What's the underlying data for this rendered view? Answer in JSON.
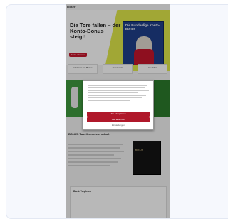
{
  "site": {
    "logo": "kicker"
  },
  "hero": {
    "headline": "Die Tore fallen – der Konto-Bonus steigt!",
    "cta_label": "Mehr erfahren",
    "magazine_title": "Die Bundesliga Konto-Bonus"
  },
  "tabs": [
    {
      "label": "Girokonto mit Bonus"
    },
    {
      "label": "Zum Konto"
    },
    {
      "label": "Alle Infos"
    }
  ],
  "article": {
    "heading": "BONUS Tabellenmeisterschaft",
    "book_title": "BONUS"
  },
  "footer": {
    "title": "Bank Vergleich"
  },
  "cookie_modal": {
    "accept_label": "Alle akzeptieren",
    "reject_label": "Alle ablehnen",
    "settings_label": "Einstellungen"
  },
  "colors": {
    "accent": "#c5162c",
    "hero_yellow": "#dfe84a",
    "pitch_green": "#3f9a3f"
  }
}
